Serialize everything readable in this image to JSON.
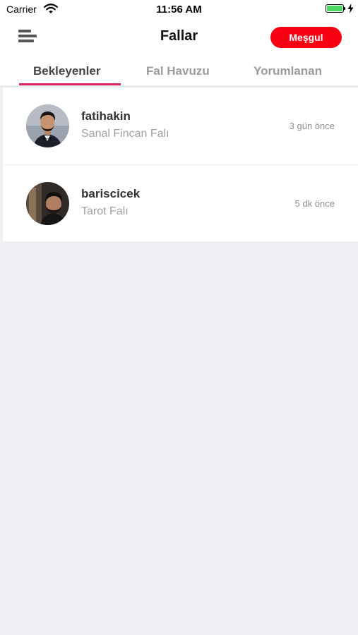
{
  "status_bar": {
    "carrier": "Carrier",
    "time": "11:56 AM",
    "battery_color": "#4cd964"
  },
  "header": {
    "menu_icon": "menu-lines-icon",
    "title": "Fallar",
    "status_label": "Meşgul",
    "status_color": "#f80012"
  },
  "tabs": [
    {
      "label": "Bekleyenler",
      "active": true
    },
    {
      "label": "Fal Havuzu",
      "active": false
    },
    {
      "label": "Yorumlanan",
      "active": false
    }
  ],
  "tab_indicator_color": "#e0245e",
  "items": [
    {
      "username": "fatihakin",
      "fortune_type": "Sanal Fincan Falı",
      "time": "3 gün önce",
      "avatar_icon": "user-avatar-photo"
    },
    {
      "username": "bariscicek",
      "fortune_type": "Tarot Falı",
      "time": "5 dk önce",
      "avatar_icon": "user-avatar-photo"
    }
  ]
}
